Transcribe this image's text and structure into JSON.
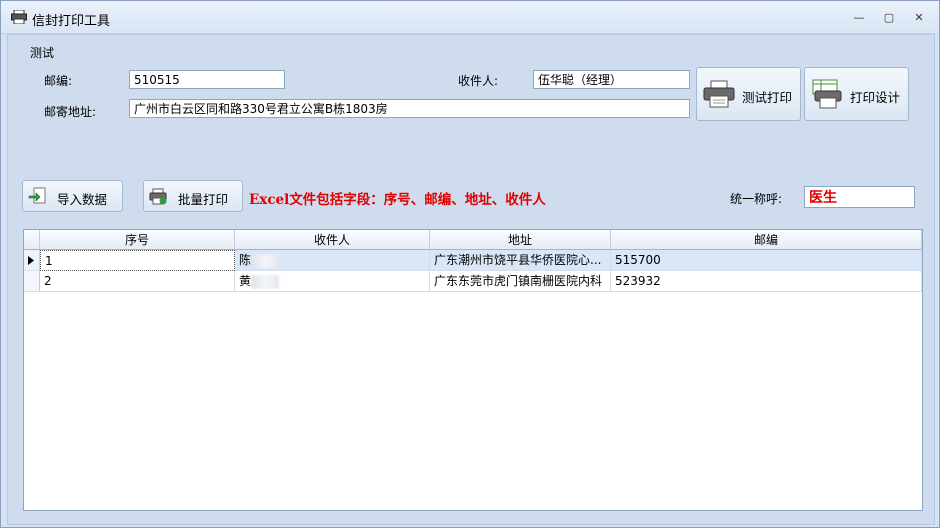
{
  "window": {
    "title": "信封打印工具",
    "minimize": "—",
    "maximize": "▢",
    "close": "✕"
  },
  "form": {
    "group_label": "测试",
    "zip_label": "邮编:",
    "zip_value": "510515",
    "recipient_label": "收件人:",
    "recipient_value": "伍华聪（经理）",
    "address_label": "邮寄地址:",
    "address_value": "广州市白云区同和路330号君立公寓B栋1803房"
  },
  "buttons": {
    "test_print": "测试打印",
    "print_design": "打印设计",
    "import": "导入数据",
    "batch_print": "批量打印"
  },
  "hint": {
    "text": "Excel文件包括字段：序号、邮编、地址、收件人",
    "color": "#e00000"
  },
  "salutation": {
    "label": "统一称呼:",
    "value": "医生",
    "color": "#e00000"
  },
  "table": {
    "columns": [
      "序号",
      "收件人",
      "地址",
      "邮编"
    ],
    "rows": [
      {
        "seq": "1",
        "recipient": "陈",
        "address": "广东潮州市饶平县华侨医院心...",
        "zip": "515700"
      },
      {
        "seq": "2",
        "recipient": "黄",
        "address": "广东东莞市虎门镇南栅医院内科",
        "zip": "523932"
      }
    ]
  },
  "icons": {
    "title": "printer-icon",
    "test_print": "printer-icon",
    "print_design": "print-design-icon",
    "import": "import-icon",
    "batch_print": "batch-print-icon"
  }
}
